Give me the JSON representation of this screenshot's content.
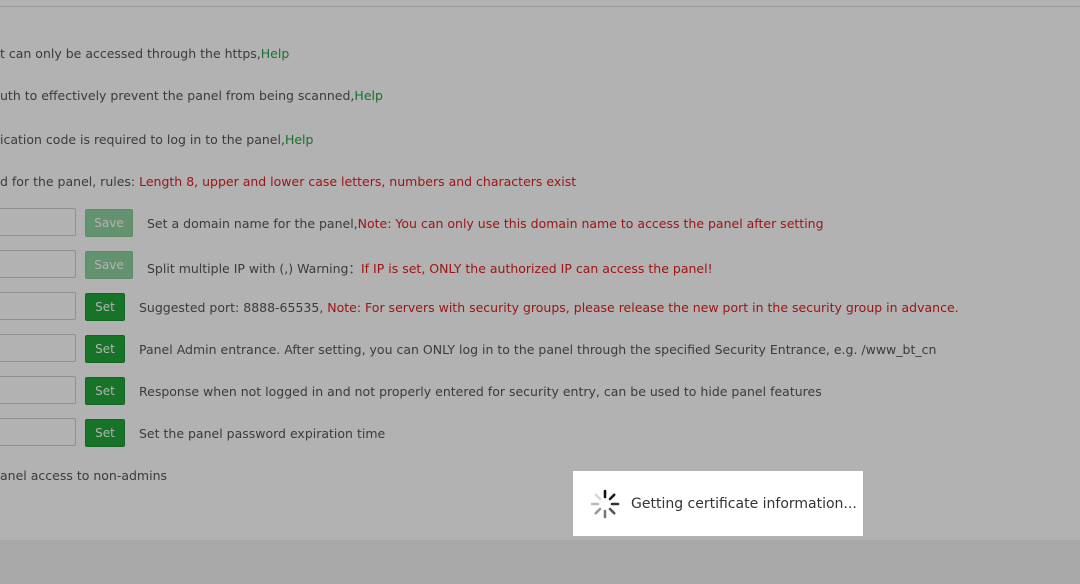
{
  "settings": {
    "rows": [
      {
        "text": "t can only be accessed through the https,",
        "help": "Help"
      },
      {
        "text": "uth to effectively prevent the panel from being scanned,",
        "help": "Help"
      },
      {
        "text": "ication code is required to log in to the panel,",
        "help": "Help"
      },
      {
        "text": "d for the panel, rules: ",
        "red": "Length 8, upper and lower case letters, numbers and characters exist"
      }
    ],
    "domain": {
      "button": "Save",
      "text": "Set a domain name for the panel,",
      "note": "Note: You can only use this domain name to access the panel after setting"
    },
    "ip": {
      "button": "Save",
      "text": "Split multiple IP with (,) Warning：",
      "note": "If IP is set, ONLY the authorized IP can access the panel!"
    },
    "port": {
      "button": "Set",
      "text": "Suggested port: 8888-65535, ",
      "note": "Note: For servers with security groups, please release the new port in the security group in advance."
    },
    "entrance": {
      "button": "Set",
      "text": "Panel Admin entrance. After setting, you can ONLY log in to the panel through the specified Security Entrance, e.g. /www_bt_cn"
    },
    "response": {
      "button": "Set",
      "text": "Response when not logged in and not properly entered for security entry, can be used to hide panel features"
    },
    "expiration": {
      "button": "Set",
      "text": "Set the panel password expiration time"
    },
    "last_row": {
      "text": "anel access to non-admins"
    }
  },
  "loading": {
    "text": "Getting certificate information...",
    "icon": "spinner-icon"
  },
  "colors": {
    "accent": "#20a53a",
    "warning": "#e31d1d",
    "save_disabled": "#8fd19e"
  }
}
